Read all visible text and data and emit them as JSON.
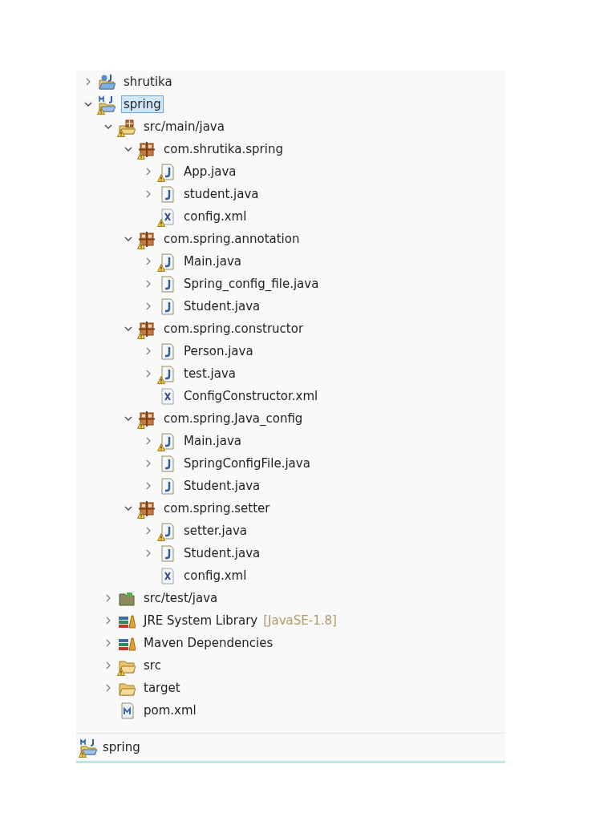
{
  "tree": [
    {
      "label": "shrutika",
      "kind": "project",
      "expanded": false,
      "warning": false,
      "selected": false
    },
    {
      "label": "spring",
      "kind": "maven-project",
      "expanded": true,
      "warning": true,
      "selected": true,
      "children": [
        {
          "label": "src/main/java",
          "kind": "source-folder",
          "expanded": true,
          "warning": true,
          "selected": false,
          "children": [
            {
              "label": "com.shrutika.spring",
              "kind": "package",
              "expanded": true,
              "warning": true,
              "selected": false,
              "children": [
                {
                  "label": "App.java",
                  "kind": "java",
                  "expanded": false,
                  "warning": true,
                  "selected": false
                },
                {
                  "label": "student.java",
                  "kind": "java",
                  "expanded": false,
                  "warning": false,
                  "selected": false
                },
                {
                  "label": "config.xml",
                  "kind": "xml",
                  "warning": true,
                  "selected": false
                }
              ]
            },
            {
              "label": "com.spring.annotation",
              "kind": "package",
              "expanded": true,
              "warning": true,
              "selected": false,
              "children": [
                {
                  "label": "Main.java",
                  "kind": "java",
                  "expanded": false,
                  "warning": true,
                  "selected": false
                },
                {
                  "label": "Spring_config_file.java",
                  "kind": "java",
                  "expanded": false,
                  "warning": false,
                  "selected": false
                },
                {
                  "label": "Student.java",
                  "kind": "java",
                  "expanded": false,
                  "warning": false,
                  "selected": false
                }
              ]
            },
            {
              "label": "com.spring.constructor",
              "kind": "package",
              "expanded": true,
              "warning": true,
              "selected": false,
              "children": [
                {
                  "label": "Person.java",
                  "kind": "java",
                  "expanded": false,
                  "warning": false,
                  "selected": false
                },
                {
                  "label": "test.java",
                  "kind": "java",
                  "expanded": false,
                  "warning": true,
                  "selected": false
                },
                {
                  "label": "ConfigConstructor.xml",
                  "kind": "xml",
                  "warning": false,
                  "selected": false
                }
              ]
            },
            {
              "label": "com.spring.Java_config",
              "kind": "package",
              "expanded": true,
              "warning": true,
              "selected": false,
              "children": [
                {
                  "label": "Main.java",
                  "kind": "java",
                  "expanded": false,
                  "warning": true,
                  "selected": false
                },
                {
                  "label": "SpringConfigFile.java",
                  "kind": "java",
                  "expanded": false,
                  "warning": false,
                  "selected": false
                },
                {
                  "label": "Student.java",
                  "kind": "java",
                  "expanded": false,
                  "warning": false,
                  "selected": false
                }
              ]
            },
            {
              "label": "com.spring.setter",
              "kind": "package",
              "expanded": true,
              "warning": true,
              "selected": false,
              "children": [
                {
                  "label": "setter.java",
                  "kind": "java",
                  "expanded": false,
                  "warning": true,
                  "selected": false
                },
                {
                  "label": "Student.java",
                  "kind": "java",
                  "expanded": false,
                  "warning": false,
                  "selected": false
                },
                {
                  "label": "config.xml",
                  "kind": "xml",
                  "warning": false,
                  "selected": false
                }
              ]
            }
          ]
        },
        {
          "label": "src/test/java",
          "kind": "test-folder",
          "expanded": false,
          "warning": false,
          "selected": false
        },
        {
          "label": "JRE System Library",
          "decoration": "[JavaSE-1.8]",
          "kind": "library",
          "expanded": false,
          "warning": false,
          "selected": false
        },
        {
          "label": "Maven Dependencies",
          "kind": "library",
          "expanded": false,
          "warning": false,
          "selected": false
        },
        {
          "label": "src",
          "kind": "folder",
          "expanded": false,
          "warning": true,
          "selected": false
        },
        {
          "label": "target",
          "kind": "folder",
          "expanded": false,
          "warning": false,
          "selected": false
        },
        {
          "label": "pom.xml",
          "kind": "pom",
          "warning": false,
          "selected": false
        }
      ]
    }
  ],
  "status_bar": {
    "label": "spring",
    "kind": "maven-project",
    "warning": true
  }
}
